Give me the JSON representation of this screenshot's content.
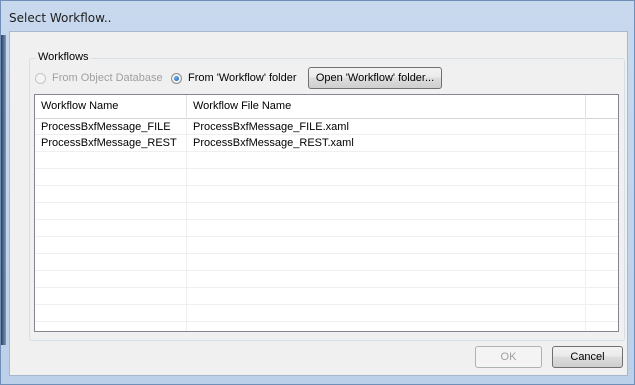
{
  "window": {
    "title": "Select Workflow.."
  },
  "workflows_group": {
    "label": "Workflows",
    "radio_object_database": "From Object Database",
    "radio_workflow_folder": "From 'Workflow' folder",
    "open_folder_button": "Open 'Workflow' folder..."
  },
  "list": {
    "columns": [
      "Workflow Name",
      "Workflow File Name"
    ],
    "rows": [
      [
        "ProcessBxfMessage_FILE",
        "ProcessBxfMessage_FILE.xaml"
      ],
      [
        "ProcessBxfMessage_REST",
        "ProcessBxfMessage_REST.xaml"
      ]
    ]
  },
  "footer": {
    "ok_label": "OK",
    "cancel_label": "Cancel"
  },
  "colors": {
    "title_bar": "#bcd0ea",
    "client_bg": "#f0f0f0",
    "radio_selected": "#1a4f9a"
  }
}
